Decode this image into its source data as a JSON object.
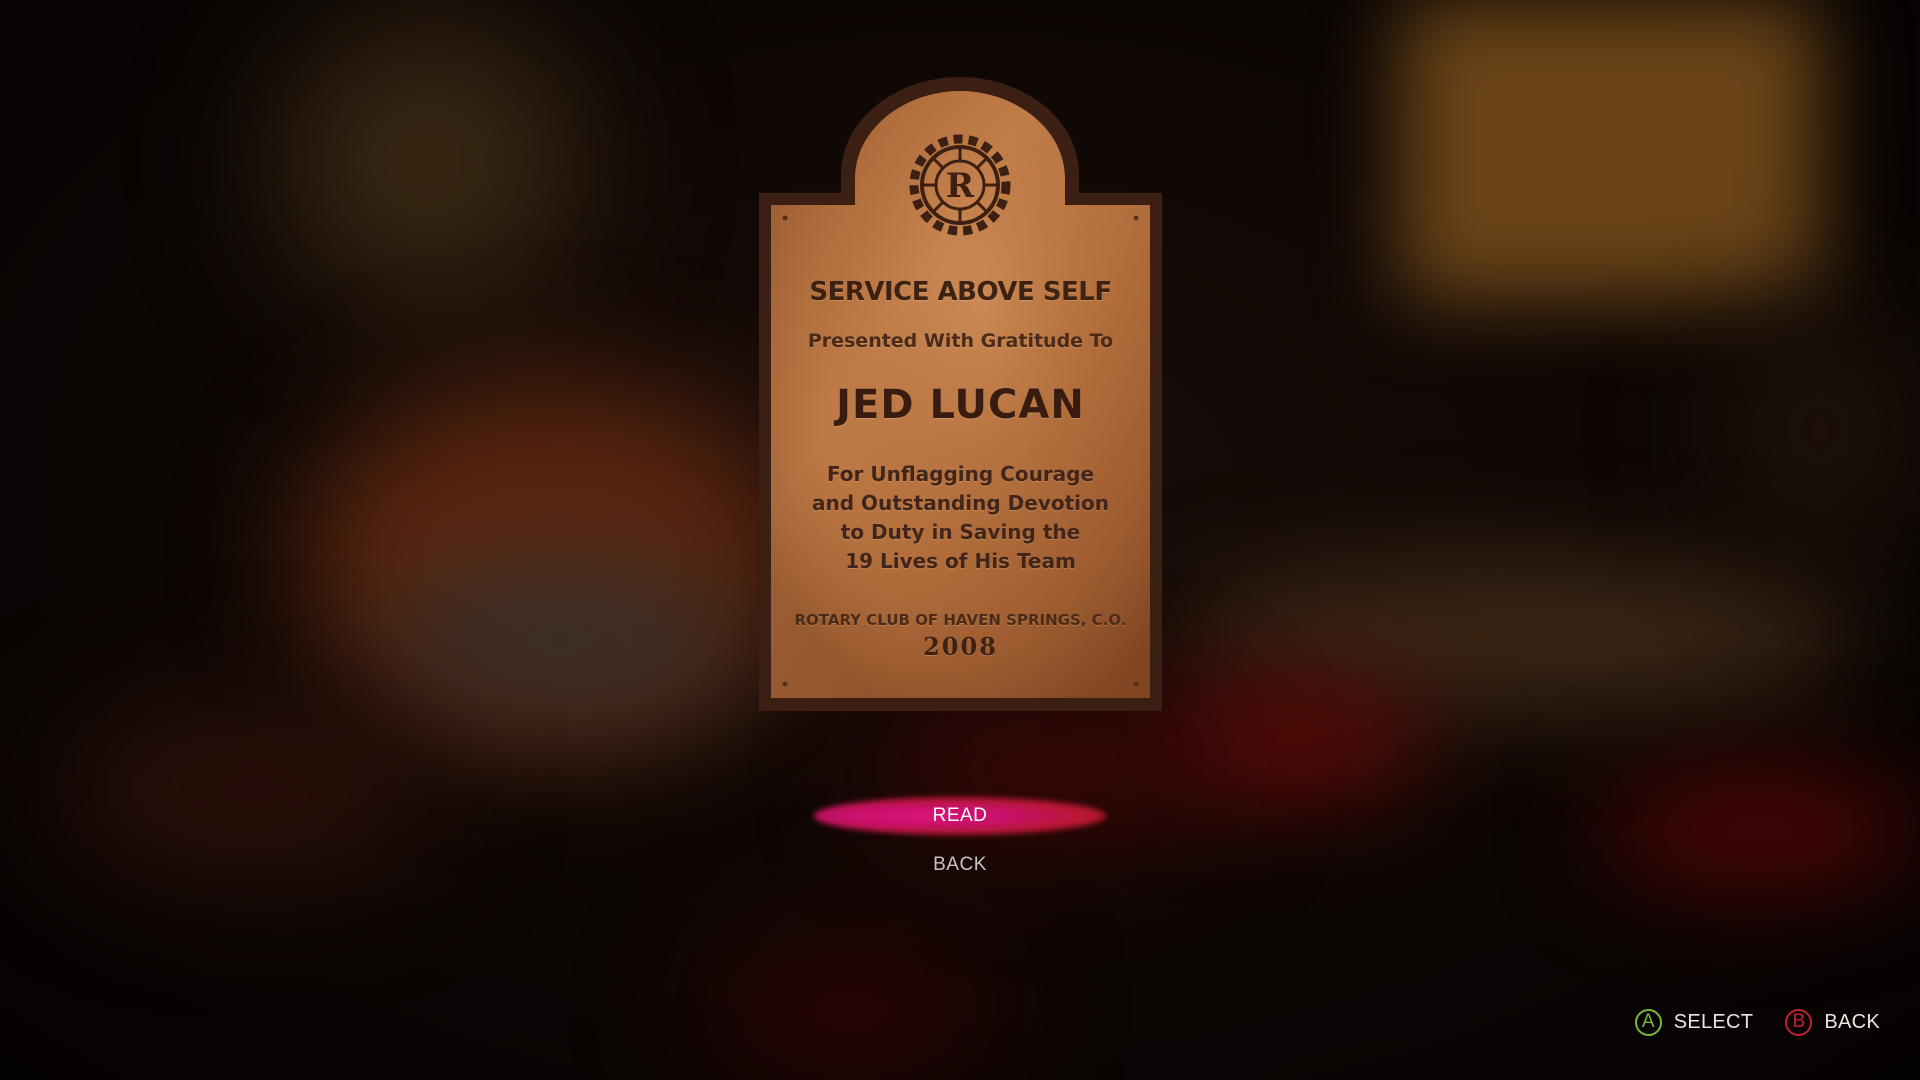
{
  "plaque": {
    "emblem_letter": "R",
    "motto": "SERVICE ABOVE SELF",
    "presented": "Presented With Gratitude To",
    "name": "JED LUCAN",
    "dedication": [
      "For Unflagging Courage",
      "and Outstanding Devotion",
      "to Duty in Saving the",
      "19 Lives of His Team"
    ],
    "club": "ROTARY CLUB OF HAVEN SPRINGS, C.O.",
    "year": "2008"
  },
  "menu": {
    "items": [
      {
        "label": "READ",
        "selected": true
      },
      {
        "label": "BACK",
        "selected": false
      }
    ]
  },
  "prompts": [
    {
      "button": "A",
      "label": "SELECT",
      "color": "#7bb83a"
    },
    {
      "button": "B",
      "label": "BACK",
      "color": "#c2222e"
    }
  ],
  "colors": {
    "highlight_start": "#e0147c",
    "highlight_end": "#b81830",
    "plaque_bronze": "#b8723f",
    "plaque_frame": "#3a2014"
  }
}
